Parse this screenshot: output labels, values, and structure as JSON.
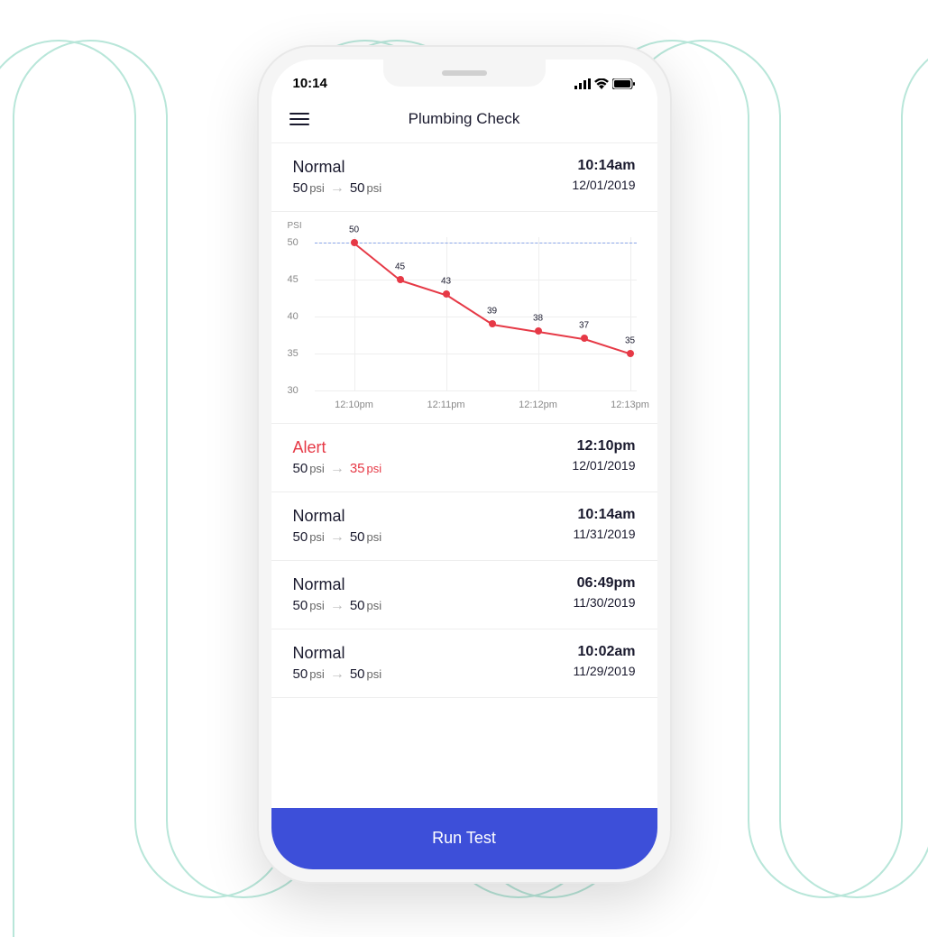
{
  "status_bar": {
    "time": "10:14"
  },
  "header": {
    "title": "Plumbing Check"
  },
  "entries": [
    {
      "status": "Normal",
      "alert": false,
      "from": "50",
      "to": "50",
      "to_alert": false,
      "time": "10:14am",
      "date": "12/01/2019"
    },
    {
      "status": "Alert",
      "alert": true,
      "from": "50",
      "to": "35",
      "to_alert": true,
      "time": "12:10pm",
      "date": "12/01/2019"
    },
    {
      "status": "Normal",
      "alert": false,
      "from": "50",
      "to": "50",
      "to_alert": false,
      "time": "10:14am",
      "date": "11/31/2019"
    },
    {
      "status": "Normal",
      "alert": false,
      "from": "50",
      "to": "50",
      "to_alert": false,
      "time": "06:49pm",
      "date": "11/30/2019"
    },
    {
      "status": "Normal",
      "alert": false,
      "from": "50",
      "to": "50",
      "to_alert": false,
      "time": "10:02am",
      "date": "11/29/2019"
    }
  ],
  "chart_data": {
    "type": "line",
    "ylabel": "PSI",
    "yticks": [
      50,
      45,
      40,
      35,
      30
    ],
    "xticks": [
      "12:10pm",
      "12:11pm",
      "12:12pm",
      "12:13pm"
    ],
    "baseline": 50,
    "points": [
      {
        "x": 0.0,
        "y": 50,
        "label": "50"
      },
      {
        "x": 1.0,
        "y": 45,
        "label": "45"
      },
      {
        "x": 2.0,
        "y": 43,
        "label": "43"
      },
      {
        "x": 3.0,
        "y": 39,
        "label": "39"
      },
      {
        "x": 4.0,
        "y": 38,
        "label": "38"
      },
      {
        "x": 5.0,
        "y": 37,
        "label": "37"
      },
      {
        "x": 6.0,
        "y": 35,
        "label": "35"
      }
    ],
    "ylim": [
      30,
      50
    ],
    "xrange": [
      0,
      6
    ]
  },
  "run_button": {
    "label": "Run Test"
  },
  "psi_unit": "psi",
  "colors": {
    "alert": "#e63946",
    "primary": "#3d4fd9"
  }
}
